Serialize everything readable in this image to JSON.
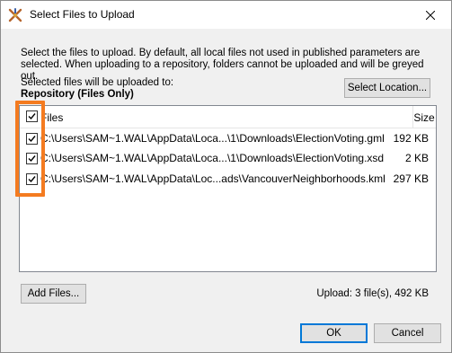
{
  "window": {
    "title": "Select Files to Upload",
    "icons": {
      "app": "fme-app-icon",
      "close": "close-icon",
      "check": "check-icon"
    }
  },
  "intro_text": "Select the files to upload. By default, all local files not used in published parameters are selected. When uploading to a repository, folders cannot be uploaded and will be greyed out.",
  "target": {
    "label": "Selected files will be uploaded to:",
    "value": "Repository (Files Only)"
  },
  "select_location_label": "Select Location...",
  "file_list": {
    "header_checked": true,
    "columns": {
      "files": "Files",
      "size": "Size"
    },
    "rows": [
      {
        "checked": true,
        "path": "C:\\Users\\SAM~1.WAL\\AppData\\Loca...\\1\\Downloads\\ElectionVoting.gml",
        "size": "192 KB"
      },
      {
        "checked": true,
        "path": "C:\\Users\\SAM~1.WAL\\AppData\\Loca...\\1\\Downloads\\ElectionVoting.xsd",
        "size": "2 KB"
      },
      {
        "checked": true,
        "path": "C:\\Users\\SAM~1.WAL\\AppData\\Loc...ads\\VancouverNeighborhoods.kml",
        "size": "297 KB"
      }
    ]
  },
  "add_files_label": "Add Files...",
  "upload_summary": "Upload: 3 file(s), 492 KB",
  "ok_label": "OK",
  "cancel_label": "Cancel",
  "colors": {
    "highlight": "#f47b20",
    "default_button": "#0078d7"
  }
}
